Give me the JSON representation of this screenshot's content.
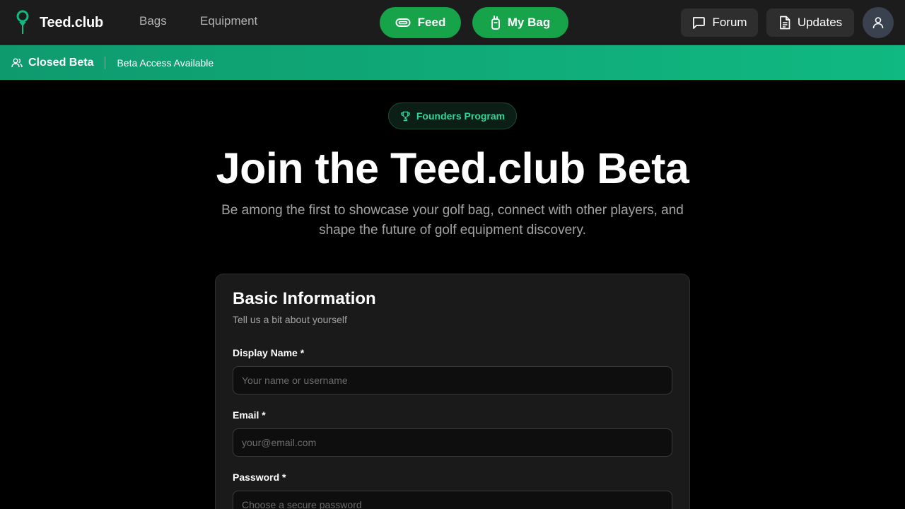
{
  "nav": {
    "brand": "Teed.club",
    "links": {
      "bags": "Bags",
      "equipment": "Equipment"
    },
    "feed_label": "Feed",
    "my_bag_label": "My Bag",
    "forum_label": "Forum",
    "updates_label": "Updates",
    "icons": {
      "brand": "golf-tee-icon",
      "feed": "golf-ball-icon",
      "my_bag": "golf-bag-icon",
      "forum": "message-square-icon",
      "updates": "document-icon",
      "avatar": "user-icon"
    }
  },
  "banner": {
    "title": "Closed Beta",
    "subtitle": "Beta Access Available",
    "icon": "users-icon"
  },
  "hero": {
    "badge": "Founders Program",
    "badge_icon": "trophy-icon",
    "title": "Join the Teed.club Beta",
    "subtitle": "Be among the first to showcase your golf bag, connect with other players, and shape the future of golf equipment discovery."
  },
  "form": {
    "title": "Basic Information",
    "subtitle": "Tell us a bit about yourself",
    "fields": [
      {
        "label": "Display Name *",
        "placeholder": "Your name or username",
        "value": ""
      },
      {
        "label": "Email *",
        "placeholder": "your@email.com",
        "value": ""
      },
      {
        "label": "Password *",
        "placeholder": "Choose a secure password",
        "value": ""
      }
    ]
  },
  "colors": {
    "accent_green": "#16a34a",
    "banner_green": "#10b981",
    "badge_text": "#34d399",
    "navbar_bg": "#1c1c1c",
    "page_bg": "#000000",
    "card_bg": "#1a1a1a"
  }
}
